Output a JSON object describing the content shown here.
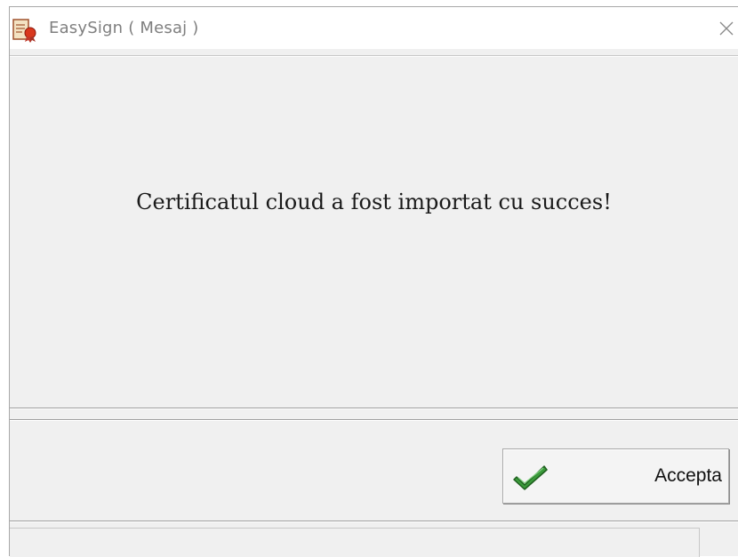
{
  "window": {
    "title": "EasySign ( Mesaj )",
    "app_icon": "certificate-seal-icon",
    "close_icon": "close-icon"
  },
  "message": {
    "text": "Certificatul cloud a fost importat cu succes!"
  },
  "buttons": {
    "accept_label": "Accepta",
    "accept_icon": "green-checkmark-icon"
  },
  "status_bar": {
    "text": ""
  },
  "colors": {
    "dialog_background": "#f0f0f0",
    "title_text": "#7f7f7f",
    "checkmark": "#2e8b2e"
  }
}
